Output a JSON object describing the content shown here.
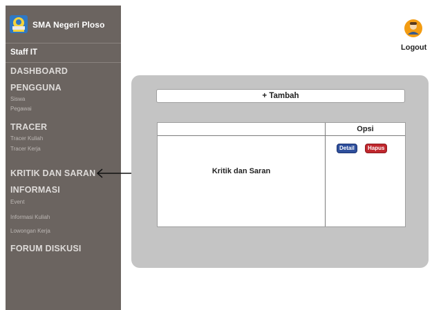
{
  "sidebar": {
    "brand": "SMA Negeri Ploso",
    "role": "Staff IT",
    "sections": [
      {
        "title": "DASHBOARD",
        "items": []
      },
      {
        "title": "PENGGUNA",
        "items": [
          "Siswa",
          "Pegawai"
        ]
      },
      {
        "title": "TRACER",
        "items": [
          "Tracer Kuliah",
          "Tracer Kerja"
        ]
      },
      {
        "title": "KRITIK DAN SARAN",
        "items": []
      },
      {
        "title": "INFORMASI",
        "items": [
          "Event",
          "Informasi Kuliah",
          "Lowongan Kerja"
        ]
      },
      {
        "title": "FORUM DISKUSI",
        "items": []
      }
    ]
  },
  "header": {
    "logout_label": "Logout",
    "profile_icon": "user-avatar-icon"
  },
  "main": {
    "add_button_label": "+ Tambah",
    "table": {
      "columns": [
        "",
        "Opsi"
      ],
      "row_text": "Kritik dan Saran",
      "actions": [
        "Detail",
        "Hapus"
      ]
    }
  },
  "colors": {
    "sidebar_bg": "#6b6460",
    "panel_bg": "#c4c4c4",
    "detail_btn": "#2e4f9c",
    "hapus_btn": "#c0272d"
  }
}
